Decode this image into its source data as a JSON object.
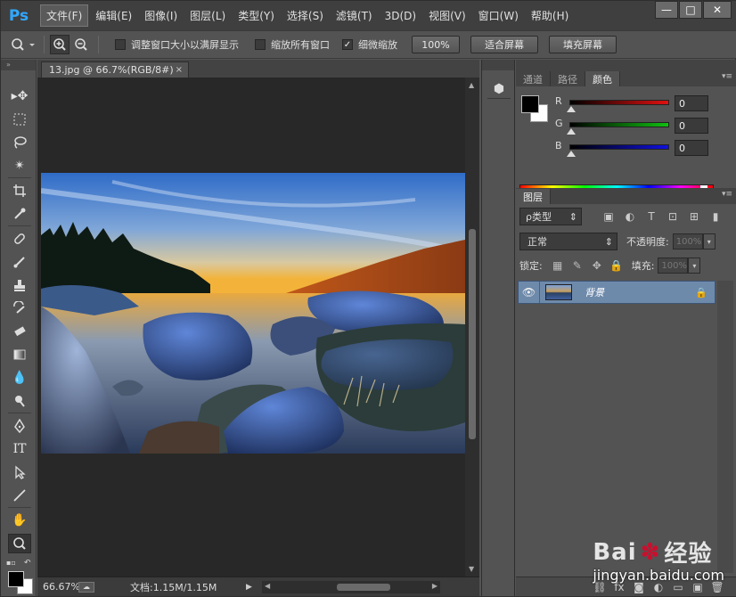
{
  "app": {
    "logo": "Ps",
    "menus": [
      "文件(F)",
      "编辑(E)",
      "图像(I)",
      "图层(L)",
      "类型(Y)",
      "选择(S)",
      "滤镜(T)",
      "3D(D)",
      "视图(V)",
      "窗口(W)",
      "帮助(H)"
    ],
    "window_controls": [
      "—",
      "□",
      "✕"
    ]
  },
  "options": {
    "checkbox_resize": "调整窗口大小以满屏显示",
    "checkbox_zoom_all": "缩放所有窗口",
    "checkbox_scrubby": "细微缩放",
    "btn_100": "100%",
    "btn_fit": "适合屏幕",
    "btn_fill": "填充屏幕"
  },
  "document": {
    "tab_title": "13.jpg @ 66.7%(RGB/8#)",
    "tab_close": "×"
  },
  "status": {
    "zoom": "66.67%",
    "doc_info": "文档:1.15M/1.15M"
  },
  "color_panel": {
    "tabs": [
      "通道",
      "路径",
      "颜色"
    ],
    "active_tab": "颜色",
    "sliders": [
      {
        "label": "R",
        "value": "0",
        "color": "#e01010"
      },
      {
        "label": "G",
        "value": "0",
        "color": "#10c010"
      },
      {
        "label": "B",
        "value": "0",
        "color": "#1010e0"
      }
    ]
  },
  "layers_panel": {
    "tab": "图层",
    "kind": "ρ类型",
    "blend_mode": "正常",
    "opacity_label": "不透明度:",
    "opacity_value": "100%",
    "lock_label": "锁定:",
    "fill_label": "填充:",
    "fill_value": "100%",
    "layers": [
      {
        "name": "背景",
        "visible": true,
        "locked": true
      }
    ]
  },
  "watermark": {
    "brand": "Bai",
    "brand2": "经验",
    "url": "jingyan.baidu.com"
  }
}
